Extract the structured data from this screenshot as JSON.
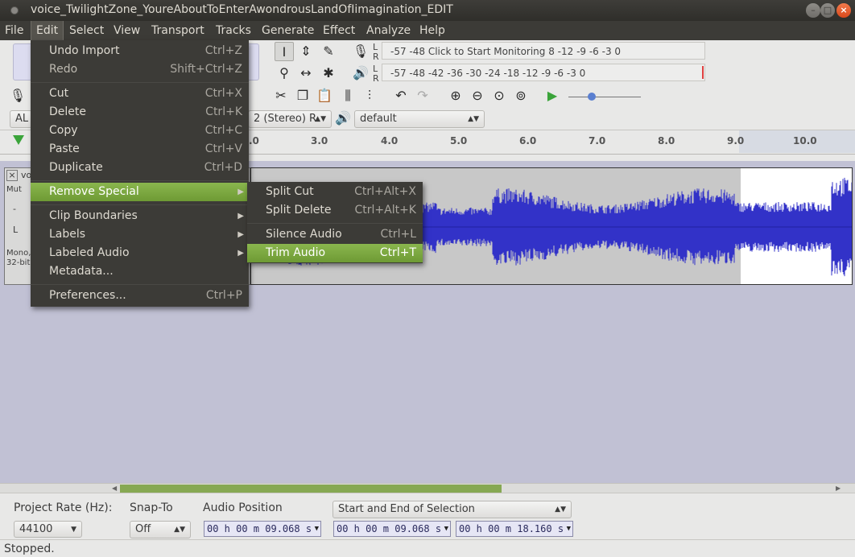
{
  "window": {
    "title": "voice_TwilightZone_YoureAboutToEnterAwondrousLandOfIimagination_EDIT"
  },
  "menubar": [
    {
      "label": "File"
    },
    {
      "label": "Edit"
    },
    {
      "label": "Select"
    },
    {
      "label": "View"
    },
    {
      "label": "Transport"
    },
    {
      "label": "Tracks"
    },
    {
      "label": "Generate"
    },
    {
      "label": "Effect"
    },
    {
      "label": "Analyze"
    },
    {
      "label": "Help"
    }
  ],
  "edit_menu": {
    "items": [
      {
        "label": "Undo Import",
        "shortcut": "Ctrl+Z"
      },
      {
        "label": "Redo",
        "shortcut": "Shift+Ctrl+Z"
      },
      {
        "label": "Cut",
        "shortcut": "Ctrl+X"
      },
      {
        "label": "Delete",
        "shortcut": "Ctrl+K"
      },
      {
        "label": "Copy",
        "shortcut": "Ctrl+C"
      },
      {
        "label": "Paste",
        "shortcut": "Ctrl+V"
      },
      {
        "label": "Duplicate",
        "shortcut": "Ctrl+D"
      },
      {
        "label": "Remove Special",
        "submenu": true
      },
      {
        "label": "Clip Boundaries",
        "submenu": true
      },
      {
        "label": "Labels",
        "submenu": true
      },
      {
        "label": "Labeled Audio",
        "submenu": true
      },
      {
        "label": "Metadata...",
        "shortcut": ""
      },
      {
        "label": "Preferences...",
        "shortcut": "Ctrl+P"
      }
    ]
  },
  "remove_special_menu": {
    "items": [
      {
        "label": "Split Cut",
        "shortcut": "Ctrl+Alt+X"
      },
      {
        "label": "Split Delete",
        "shortcut": "Ctrl+Alt+K"
      },
      {
        "label": "Silence Audio",
        "shortcut": "Ctrl+L"
      },
      {
        "label": "Trim Audio",
        "shortcut": "Ctrl+T"
      }
    ]
  },
  "meters": {
    "record_scale": "-57    -48    Click to Start Monitoring 8   -12 -9  -6  -3  0",
    "playback_scale": "-57    -48    -42    -36    -30    -24    -18    -12 -9  -6  -3  0",
    "L": "L",
    "R": "R"
  },
  "device_bar": {
    "host_partial": "AL",
    "channels": "2 (Stereo) R",
    "output_device": "default"
  },
  "timeline": {
    "ticks": [
      ".0",
      "3.0",
      "4.0",
      "5.0",
      "6.0",
      "7.0",
      "8.0",
      "9.0",
      "10.0"
    ]
  },
  "track": {
    "name_partial": "vo",
    "mute_partial": "Mut",
    "info_line1": "Mono,",
    "info_line2": "32-bit",
    "L": "L",
    "minus": "-"
  },
  "selection_toolbar": {
    "project_rate_label": "Project Rate (Hz):",
    "project_rate": "44100",
    "snap_to_label": "Snap-To",
    "snap_to": "Off",
    "audio_position_label": "Audio Position",
    "audio_position": "00 h 00 m 09.068 s",
    "selection_mode": "Start and End of Selection",
    "selection_start": "00 h 00 m 09.068 s",
    "selection_end": "00 h 00 m 18.160 s"
  },
  "status": {
    "text": "Stopped."
  },
  "colors": {
    "waveform": "#3232c8",
    "selection": "#ffffff",
    "highlight": "#7ba843"
  }
}
